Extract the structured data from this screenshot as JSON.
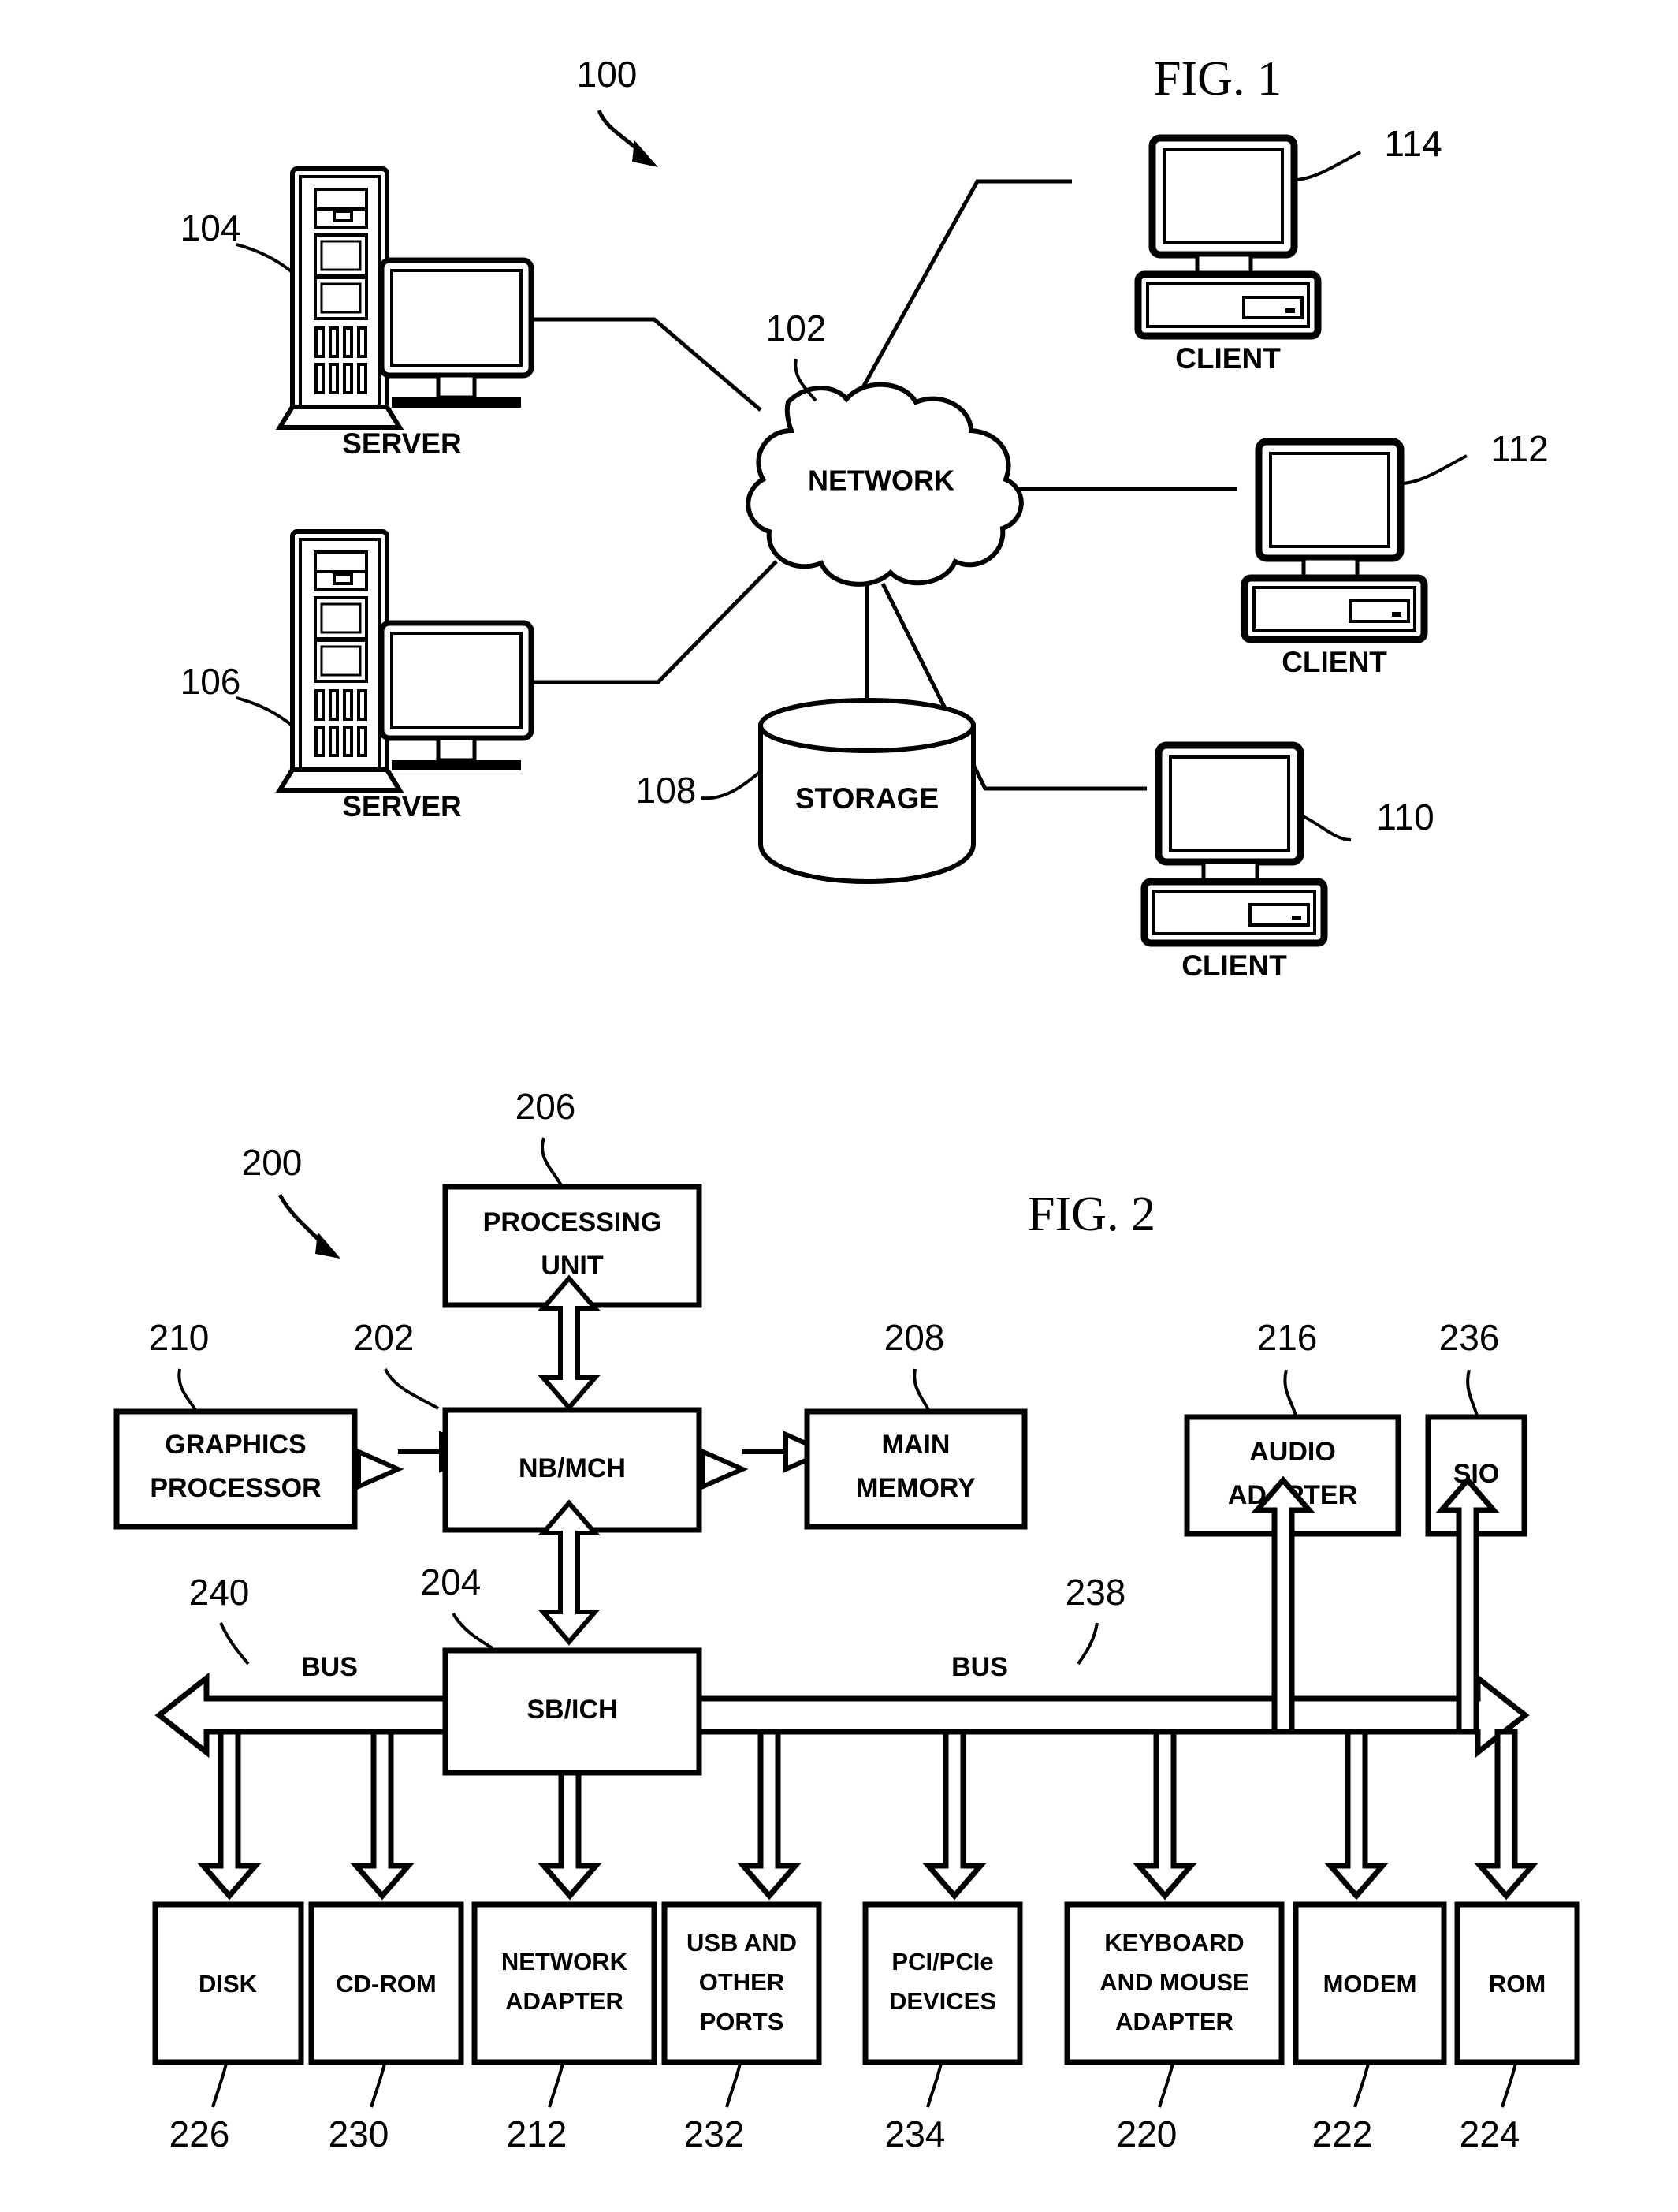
{
  "figure1": {
    "title": "FIG. 1",
    "system_ref": "100",
    "network": {
      "label": "NETWORK",
      "ref": "102"
    },
    "storage": {
      "label": "STORAGE",
      "ref": "108"
    },
    "servers": [
      {
        "label": "SERVER",
        "ref": "104"
      },
      {
        "label": "SERVER",
        "ref": "106"
      }
    ],
    "clients": [
      {
        "label": "CLIENT",
        "ref": "114"
      },
      {
        "label": "CLIENT",
        "ref": "112"
      },
      {
        "label": "CLIENT",
        "ref": "110"
      }
    ]
  },
  "figure2": {
    "title": "FIG. 2",
    "system_ref": "200",
    "processing_unit": {
      "line1": "PROCESSING",
      "line2": "UNIT",
      "ref": "206"
    },
    "nb_mch": {
      "label": "NB/MCH",
      "ref": "202"
    },
    "sb_ich": {
      "label": "SB/ICH",
      "ref": "204"
    },
    "graphics_processor": {
      "line1": "GRAPHICS",
      "line2": "PROCESSOR",
      "ref": "210"
    },
    "main_memory": {
      "line1": "MAIN",
      "line2": "MEMORY",
      "ref": "208"
    },
    "audio_adapter": {
      "line1": "AUDIO",
      "line2": "ADAPTER",
      "ref": "216"
    },
    "sio": {
      "label": "SIO",
      "ref": "236"
    },
    "bus_left": {
      "label": "BUS",
      "ref": "240"
    },
    "bus_right": {
      "label": "BUS",
      "ref": "238"
    },
    "devices": [
      {
        "lines": [
          "DISK"
        ],
        "ref": "226"
      },
      {
        "lines": [
          "CD-ROM"
        ],
        "ref": "230"
      },
      {
        "lines": [
          "NETWORK",
          "ADAPTER"
        ],
        "ref": "212"
      },
      {
        "lines": [
          "USB AND",
          "OTHER",
          "PORTS"
        ],
        "ref": "232"
      },
      {
        "lines": [
          "PCI/PCIe",
          "DEVICES"
        ],
        "ref": "234"
      },
      {
        "lines": [
          "KEYBOARD",
          "AND MOUSE",
          "ADAPTER"
        ],
        "ref": "220"
      },
      {
        "lines": [
          "MODEM"
        ],
        "ref": "222"
      },
      {
        "lines": [
          "ROM"
        ],
        "ref": "224"
      }
    ]
  },
  "colors": {
    "ink": "#000000",
    "paper": "#ffffff"
  }
}
